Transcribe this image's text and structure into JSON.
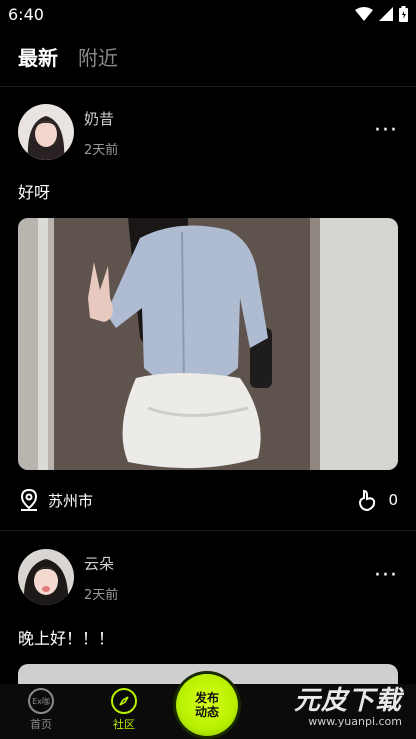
{
  "status_bar": {
    "time": "6:40"
  },
  "tabs": [
    {
      "label": "最新",
      "active": true
    },
    {
      "label": "附近",
      "active": false
    }
  ],
  "posts": [
    {
      "username": "奶昔",
      "time_ago": "2天前",
      "text": "好呀",
      "location": "苏州市",
      "likes": "0",
      "more": "···"
    },
    {
      "username": "云朵",
      "time_ago": "2天前",
      "text": "晚上好！！！",
      "more": "···"
    }
  ],
  "nav": {
    "home_label": "首页",
    "home_icon_text": "Ex咖",
    "community_label": "社区",
    "publish_label": "发布动态"
  },
  "watermark": {
    "brand": "元皮下载",
    "url": "www.yuanpi.com"
  },
  "colors": {
    "accent": "#b8f000",
    "background": "#000000"
  }
}
